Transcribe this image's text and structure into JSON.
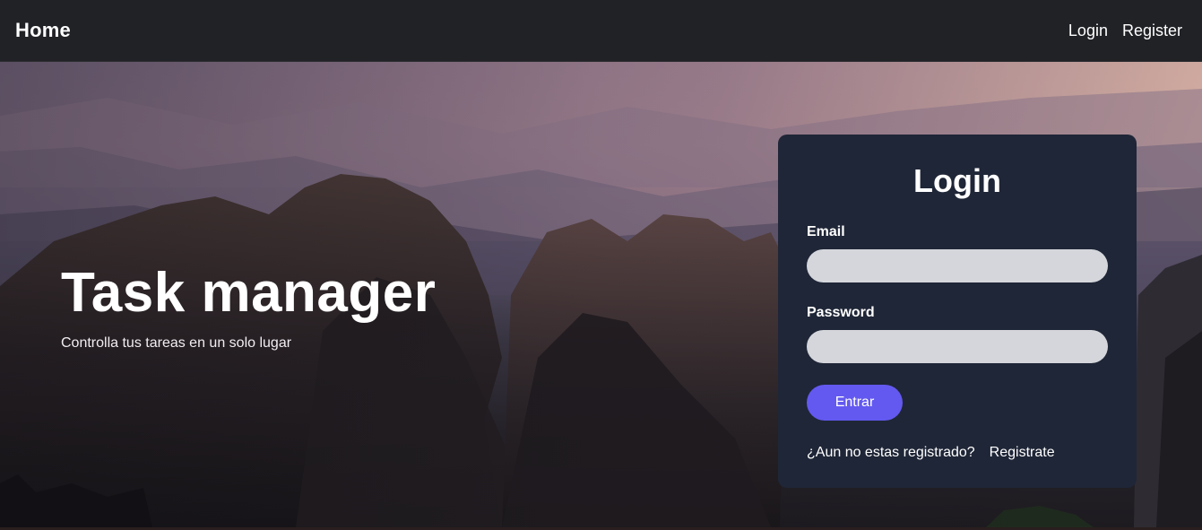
{
  "navbar": {
    "brand": "Home",
    "links": [
      {
        "label": "Login"
      },
      {
        "label": "Register"
      }
    ]
  },
  "hero": {
    "title": "Task manager",
    "subtitle": "Controlla tus tareas en un solo lugar"
  },
  "login_card": {
    "title": "Login",
    "email_label": "Email",
    "email_value": "",
    "password_label": "Password",
    "password_value": "",
    "submit_label": "Entrar",
    "register_prompt": "¿Aun no estas registrado?",
    "register_link": "Registrate"
  },
  "colors": {
    "navbar_bg": "#212226",
    "card_bg": "#1f2637",
    "input_bg": "#d4d6db",
    "button_bg": "#6359f0"
  }
}
